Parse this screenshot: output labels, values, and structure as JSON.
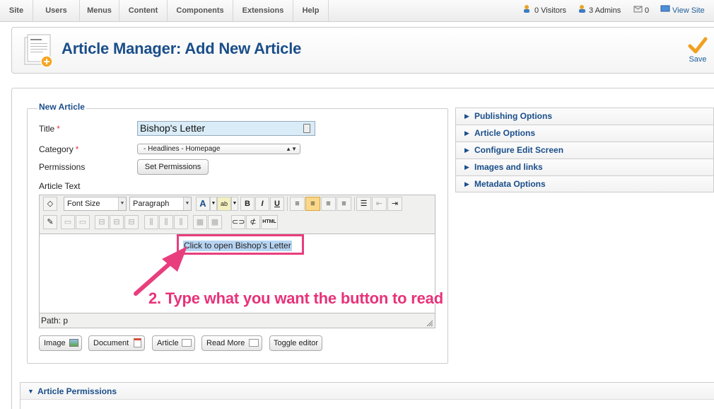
{
  "menu": [
    "Site",
    "Users",
    "Menus",
    "Content",
    "Components",
    "Extensions",
    "Help"
  ],
  "status": {
    "visitors": "0 Visitors",
    "admins": "3 Admins",
    "messages": "0",
    "view_site": "View Site"
  },
  "header": {
    "title": "Article Manager: Add New Article",
    "save_label": "Save"
  },
  "form": {
    "legend": "New Article",
    "title_label": "Title",
    "title_value": "Bishop's Letter",
    "category_label": "Category",
    "category_value": "- Headlines - Homepage",
    "permissions_label": "Permissions",
    "set_permissions": "Set Permissions",
    "article_text_label": "Article Text",
    "required_mark": "*"
  },
  "editor": {
    "font_size": "Font Size",
    "format": "Paragraph",
    "bold": "B",
    "italic": "I",
    "underline": "U",
    "html": "HTML",
    "content": "Click to open Bishop's Letter",
    "path": "Path: p"
  },
  "buttons": {
    "image": "Image",
    "document": "Document",
    "article": "Article",
    "read_more": "Read More",
    "toggle_editor": "Toggle editor"
  },
  "annotation": "2. Type what you want the button to read",
  "accordions": [
    "Publishing Options",
    "Article Options",
    "Configure Edit Screen",
    "Images and links",
    "Metadata Options"
  ],
  "permissions_panel": "Article Permissions",
  "colors": {
    "heading_blue": "#1a4e8a",
    "annotation_pink": "#e8327a",
    "title_bg": "#d9ecf7",
    "save_orange": "#f0a020"
  }
}
